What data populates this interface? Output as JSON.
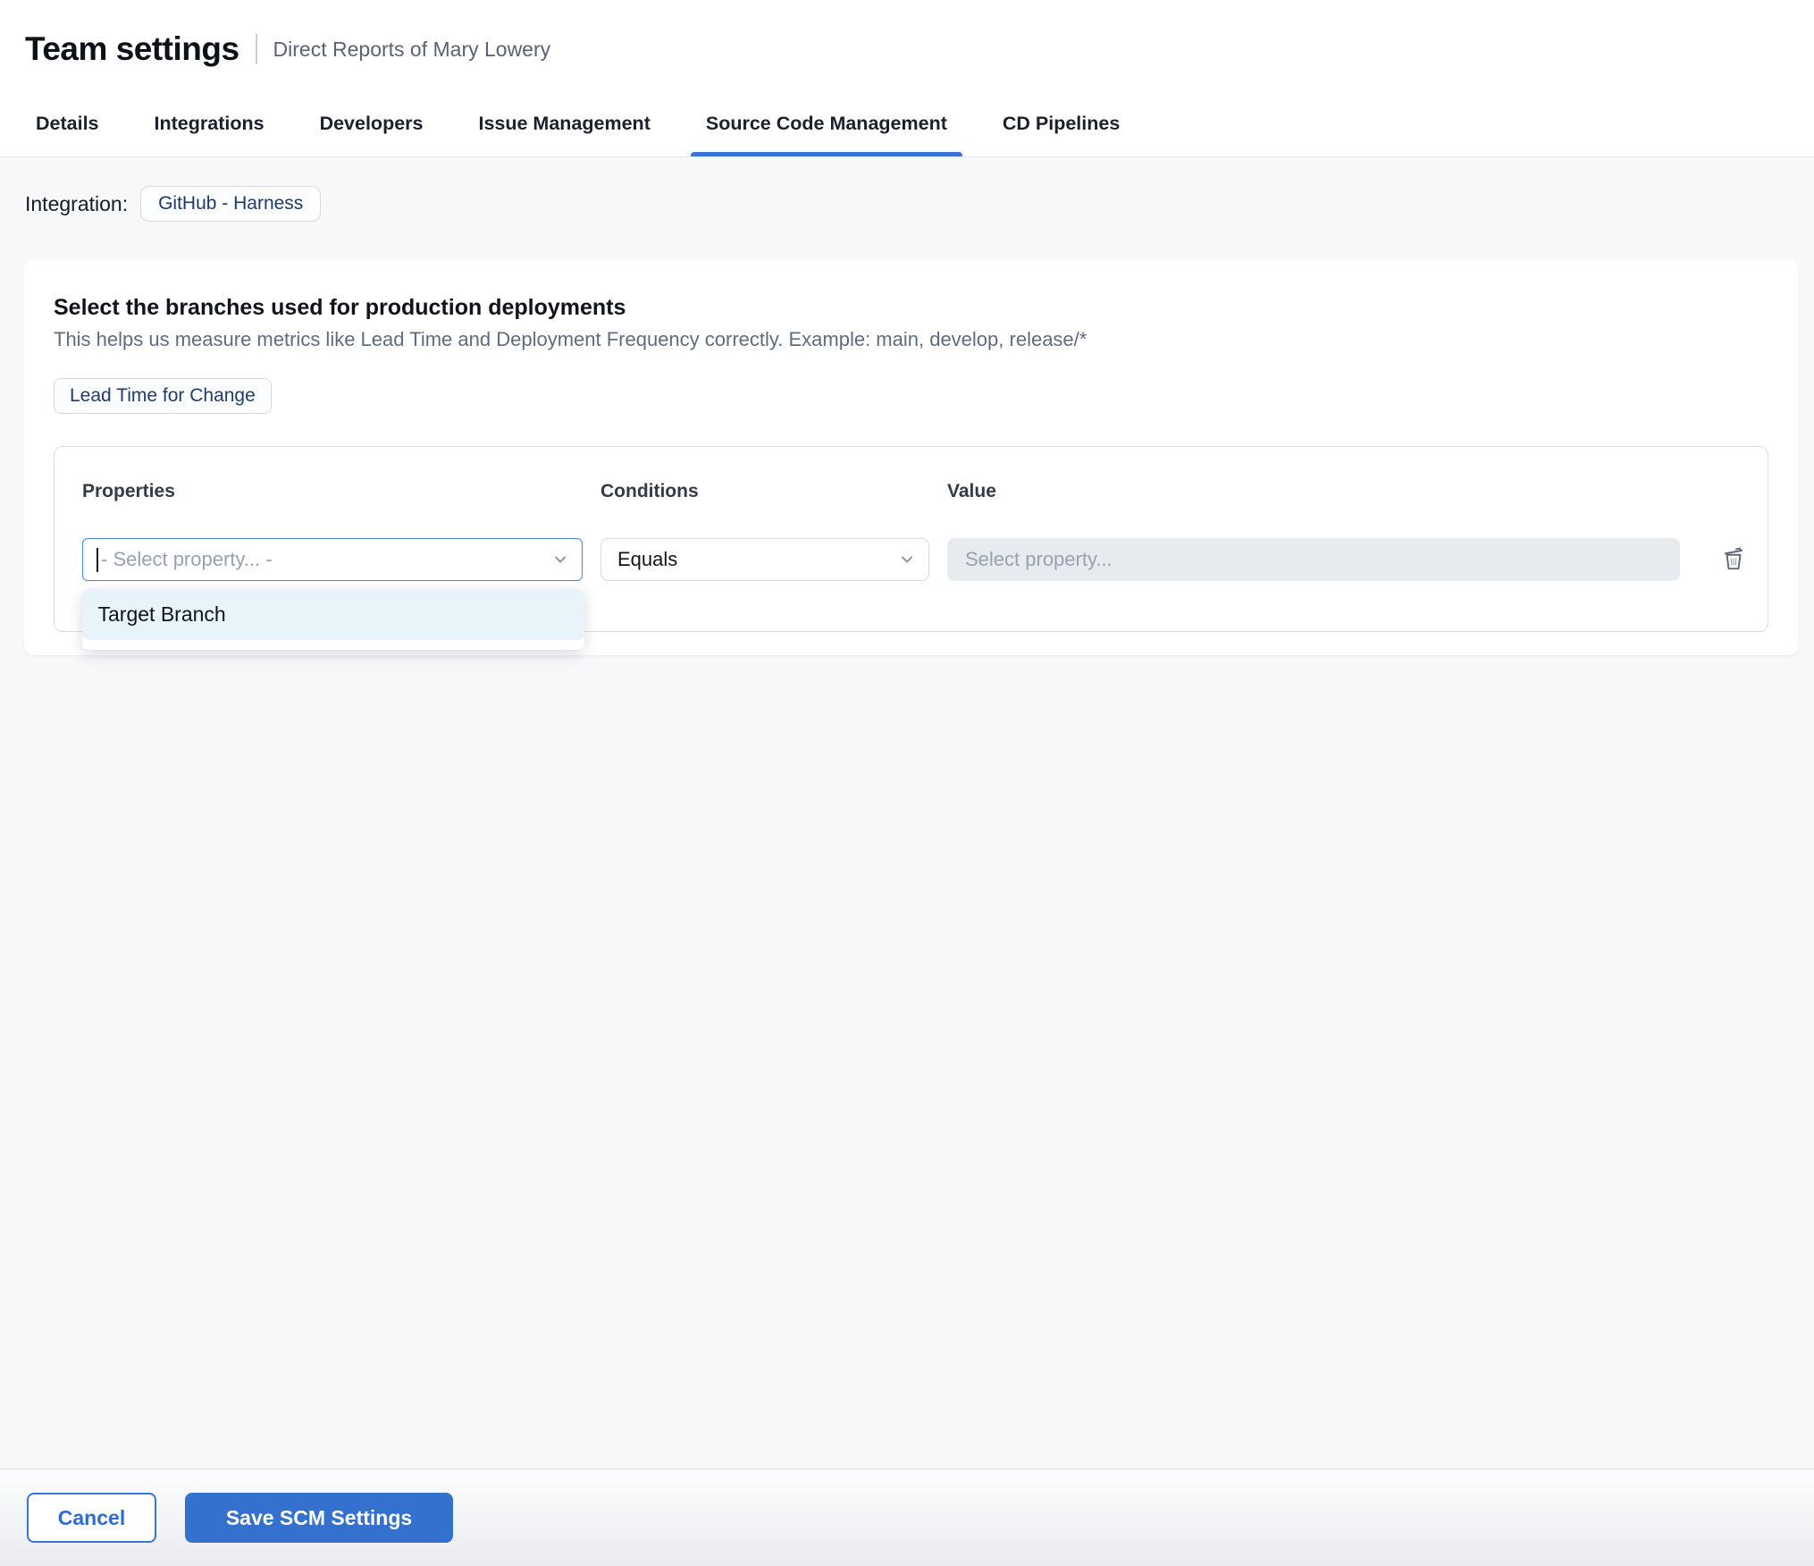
{
  "page": {
    "title": "Team settings",
    "subtitle": "Direct Reports of Mary Lowery"
  },
  "tabs": {
    "items": [
      {
        "label": "Details",
        "active": false
      },
      {
        "label": "Integrations",
        "active": false
      },
      {
        "label": "Developers",
        "active": false
      },
      {
        "label": "Issue Management",
        "active": false
      },
      {
        "label": "Source Code Management",
        "active": true
      },
      {
        "label": "CD Pipelines",
        "active": false
      }
    ]
  },
  "integration": {
    "label": "Integration:",
    "value": "GitHub - Harness"
  },
  "card": {
    "title": "Select the branches used for production deployments",
    "description": "This helps us measure metrics like Lead Time and Deployment Frequency correctly. Example: main, develop, release/*",
    "metric_chip": "Lead Time for Change"
  },
  "rule_builder": {
    "columns": {
      "properties": "Properties",
      "conditions": "Conditions",
      "value": "Value"
    },
    "property_select": {
      "placeholder": "- Select property... -",
      "state": "focused-open"
    },
    "condition_select": {
      "value": "Equals"
    },
    "value_input": {
      "placeholder": "Select property...",
      "state": "disabled"
    },
    "dropdown": {
      "options": [
        "Target Branch"
      ]
    }
  },
  "footer": {
    "cancel_label": "Cancel",
    "save_label": "Save SCM Settings"
  },
  "icons": {
    "chevron": "chevron-down",
    "delete_rule": "trash"
  },
  "colors": {
    "accent_blue": "#3470cd",
    "tab_underline": "#3b72da",
    "focus_border": "#4a84e8",
    "navy_chip_text": "#1f3c6b",
    "page_background": "#f6f8fa",
    "disabled_input_bg": "#e7ebef",
    "dropdown_highlight": "#e8f4fa"
  }
}
